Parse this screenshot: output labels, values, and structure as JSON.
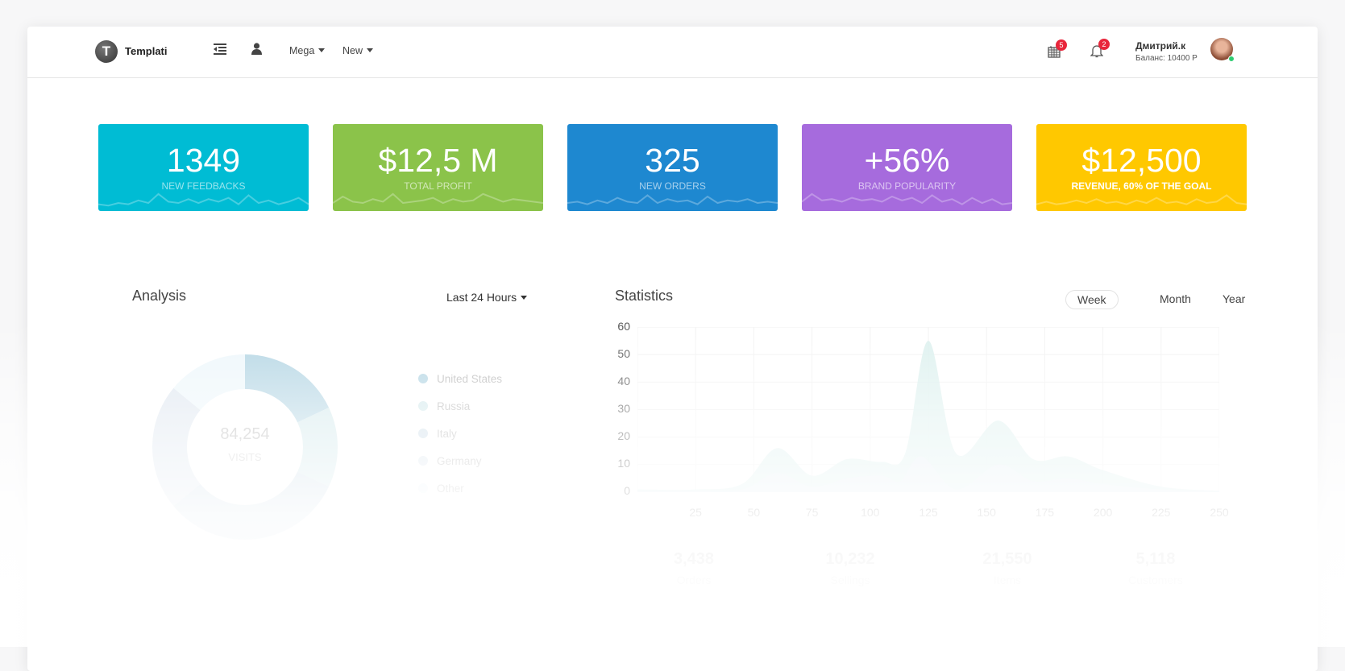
{
  "header": {
    "brand": "Templati",
    "logo_letter": "T",
    "nav": [
      {
        "label": "Mega"
      },
      {
        "label": "New"
      }
    ],
    "icons": [
      "menu-indent-icon",
      "user-icon"
    ],
    "calendar_badge": "5",
    "bell_badge": "2",
    "user_name": "Дмитрий.к",
    "balance": "Баланс: 10400 Р",
    "status": "online"
  },
  "stats": [
    {
      "value": "1349",
      "label": "New feedbacks",
      "color": "#00bcd4",
      "spark": [
        4,
        3,
        5,
        4,
        7,
        5,
        12,
        6,
        5,
        8,
        5,
        8,
        6,
        9,
        4,
        11,
        5,
        7,
        4,
        6,
        9,
        4
      ]
    },
    {
      "value": "$12,5 M",
      "label": "Total profit",
      "color": "#8bc34a",
      "spark": [
        5,
        10,
        6,
        5,
        8,
        6,
        12,
        5,
        6,
        7,
        9,
        5,
        8,
        6,
        7,
        12,
        9,
        6,
        8,
        7,
        6,
        5
      ]
    },
    {
      "value": "325",
      "label": "New orders",
      "color": "#1e88d0",
      "spark": [
        5,
        6,
        4,
        7,
        5,
        9,
        6,
        5,
        11,
        5,
        8,
        6,
        7,
        4,
        10,
        5,
        7,
        6,
        8,
        5,
        6,
        5
      ]
    },
    {
      "value": "+56%",
      "label": "Brand popularity",
      "color": "#a66bdd",
      "spark": [
        6,
        12,
        7,
        8,
        6,
        9,
        7,
        8,
        6,
        10,
        7,
        9,
        5,
        11,
        6,
        8,
        4,
        9,
        5,
        8,
        4,
        5
      ]
    },
    {
      "value": "$12,500",
      "label": "Revenue, 60% of the goal",
      "color": "#ffc800",
      "spark": [
        4,
        6,
        4,
        5,
        7,
        5,
        8,
        5,
        6,
        4,
        7,
        5,
        9,
        5,
        6,
        4,
        8,
        5,
        6,
        11,
        5,
        4
      ]
    }
  ],
  "analysis": {
    "title": "Analysis",
    "range": "Last 24 Hours",
    "center_value": "84,254",
    "center_label": "VISITS",
    "legend": [
      {
        "label": "United States",
        "color": "#b5d6e4",
        "value": 18
      },
      {
        "label": "Russia",
        "color": "#d3e9ec",
        "value": 14
      },
      {
        "label": "Italy",
        "color": "#cfdfea",
        "value": 32
      },
      {
        "label": "Germany",
        "color": "#dfe7f0",
        "value": 22
      },
      {
        "label": "Other",
        "color": "#eef7fb",
        "value": 14
      }
    ]
  },
  "statistics": {
    "title": "Statistics",
    "tabs": [
      {
        "label": "Week",
        "active": true
      },
      {
        "label": "Month"
      },
      {
        "label": "Year"
      }
    ],
    "bottom": [
      {
        "value": "3,438",
        "label": "Orders"
      },
      {
        "value": "10,232",
        "label": "Sellings"
      },
      {
        "value": "21,550",
        "label": "Items"
      },
      {
        "value": "5,118",
        "label": "Customers"
      }
    ]
  },
  "chart_data": {
    "type": "area",
    "xlim": [
      0,
      250
    ],
    "ylim": [
      0,
      60
    ],
    "grid": true,
    "yticks": [
      "60",
      "50",
      "40",
      "30",
      "20",
      "10",
      "0"
    ],
    "xticks": [
      "25",
      "50",
      "75",
      "100",
      "125",
      "150",
      "175",
      "200",
      "225",
      "250"
    ],
    "series": [
      {
        "color": "#d8efec",
        "x": [
          0,
          25,
          45,
          60,
          75,
          90,
          105,
          115,
          125,
          137,
          155,
          170,
          185,
          200,
          225,
          250
        ],
        "y": [
          1,
          1,
          3,
          16,
          6,
          12,
          11,
          14,
          55,
          14,
          26,
          12,
          13,
          8,
          2,
          0.5
        ]
      },
      {
        "color": "#e6eef4",
        "x": [
          0,
          25,
          45,
          60,
          75,
          90,
          105,
          113,
          122,
          137,
          155,
          170,
          185,
          200,
          225,
          250
        ],
        "y": [
          0.5,
          0.5,
          1,
          7,
          2,
          5,
          6,
          4,
          13,
          1,
          10,
          4,
          5,
          3,
          1,
          0.5
        ]
      }
    ]
  }
}
